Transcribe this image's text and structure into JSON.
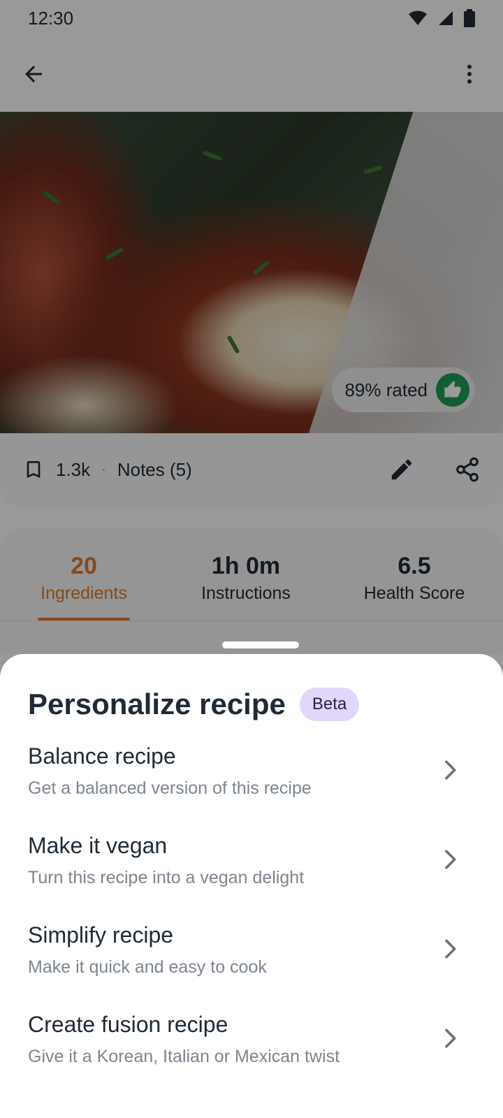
{
  "status_bar": {
    "time": "12:30"
  },
  "recipe": {
    "rating_text": "89% rated",
    "bookmark_count": "1.3k",
    "notes_label": "Notes (5)"
  },
  "tabs": [
    {
      "value": "20",
      "label": "Ingredients",
      "active": true
    },
    {
      "value": "1h 0m",
      "label": "Instructions",
      "active": false
    },
    {
      "value": "6.5",
      "label": "Health Score",
      "active": false
    }
  ],
  "sheet": {
    "title": "Personalize recipe",
    "badge": "Beta",
    "options": [
      {
        "title": "Balance recipe",
        "subtitle": "Get a balanced version of this recipe"
      },
      {
        "title": "Make it vegan",
        "subtitle": "Turn this recipe into a vegan delight"
      },
      {
        "title": "Simplify recipe",
        "subtitle": "Make it quick and easy to cook"
      },
      {
        "title": "Create fusion recipe",
        "subtitle": "Give it a Korean, Italian or Mexican twist"
      }
    ]
  },
  "colors": {
    "accent": "#e07b2a",
    "rating_green": "#1f9d55",
    "beta_badge": "#e3d6fb",
    "text_primary": "#1f2a36",
    "text_secondary": "#7d858f"
  }
}
